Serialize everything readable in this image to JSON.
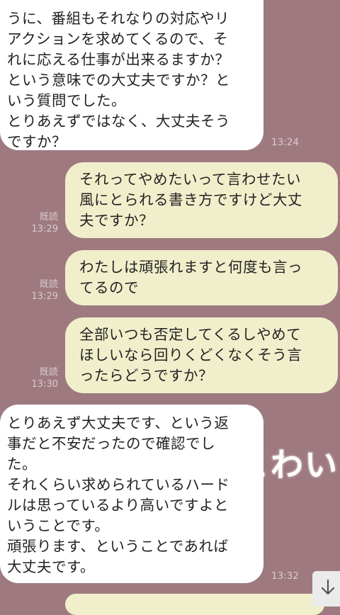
{
  "messages": [
    {
      "text": "うに、番組もそれなりの対応やリ\nアクションを求めてくるので、そ\nれに応える仕事が出来るますか？\nという意味での大丈夫ですか？と\nいう質問でした。\nとりあえずではなく、大丈夫そう\nですか？",
      "time": "13:24"
    },
    {
      "text": "それってやめたいって言わせたい\n風にとられる書き方ですけど大丈\n夫ですか？",
      "read": "既読",
      "time": "13:29"
    },
    {
      "text": "わたしは頑張れますと何度も言っ\nてるので",
      "read": "既読",
      "time": "13:29"
    },
    {
      "text": "全部いつも否定してくるしやめて\nほしいなら回りくどくなくそう言\nったらどうですか？",
      "read": "既読",
      "time": "13:30"
    },
    {
      "text": "とりあえず大丈夫です、という返\n事だと不安だったので確認でし\nた。\nそれくらい求められているハード\nルは思っているより高いですよと\nいうことです。\n頑張ります、ということであれば\n大丈夫です。",
      "time": "13:32"
    }
  ],
  "overlay_text": "こわい",
  "icons": {
    "scroll_down": "arrow-down-icon"
  },
  "colors": {
    "background": "#9e7a80",
    "incoming": "#ffffff",
    "outgoing": "#f1efcb"
  }
}
